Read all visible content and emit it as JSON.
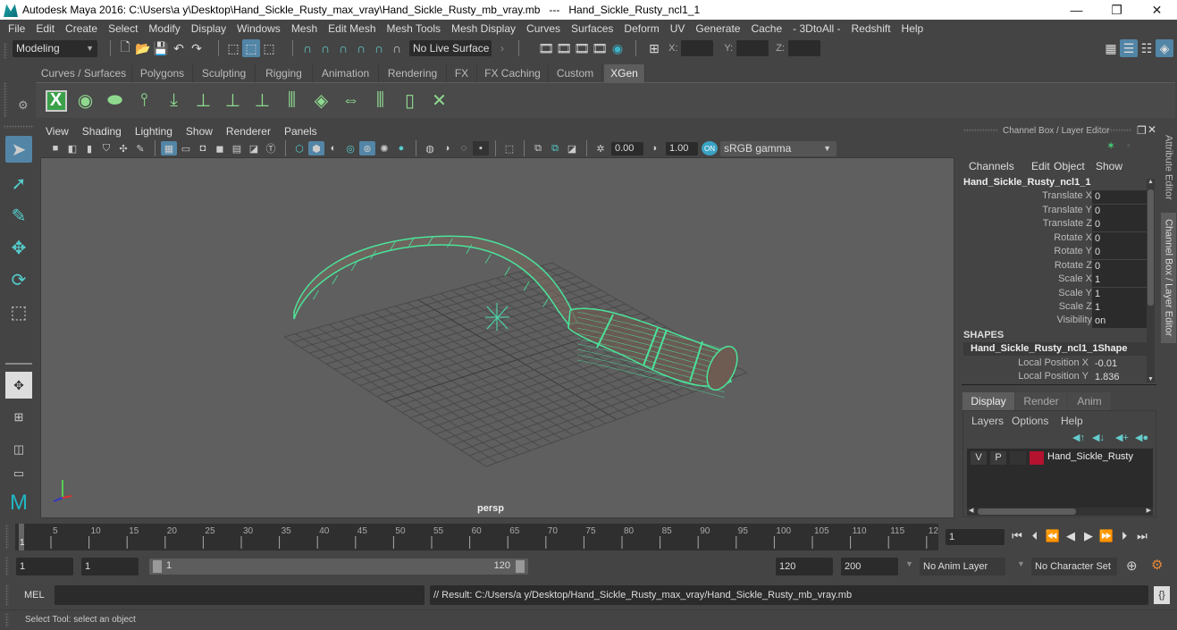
{
  "titlebar": {
    "title": "Autodesk Maya 2016: C:\\Users\\a y\\Desktop\\Hand_Sickle_Rusty_max_vray\\Hand_Sickle_Rusty_mb_vray.mb   ---   Hand_Sickle_Rusty_ncl1_1",
    "minimize": "—",
    "restore": "❐",
    "close": "✕"
  },
  "menubar": [
    "File",
    "Edit",
    "Create",
    "Select",
    "Modify",
    "Display",
    "Windows",
    "Mesh",
    "Edit Mesh",
    "Mesh Tools",
    "Mesh Display",
    "Curves",
    "Surfaces",
    "Deform",
    "UV",
    "Generate",
    "Cache",
    "- 3DtoAll -",
    "Redshift",
    "Help"
  ],
  "statusline": {
    "mode": "Modeling",
    "live_surface": "No Live Surface",
    "x_label": "X:",
    "y_label": "Y:",
    "z_label": "Z:",
    "x_value": "",
    "y_value": "",
    "z_value": ""
  },
  "shelf_tabs": [
    {
      "label": "Curves / Surfaces",
      "active": false
    },
    {
      "label": "Polygons",
      "active": false
    },
    {
      "label": "Sculpting",
      "active": false
    },
    {
      "label": "Rigging",
      "active": false
    },
    {
      "label": "Animation",
      "active": false
    },
    {
      "label": "Rendering",
      "active": false
    },
    {
      "label": "FX",
      "active": false
    },
    {
      "label": "FX Caching",
      "active": false
    },
    {
      "label": "Custom",
      "active": false
    },
    {
      "label": "XGen",
      "active": true
    }
  ],
  "shelf_icons": [
    "xgen-library-icon",
    "xgen-preview-icon",
    "xgen-clear-icon",
    "add-guides-icon",
    "place-guides-icon",
    "add-primitive-icon",
    "sculpt-guides-icon",
    "lock-length-icon",
    "guides-to-curves-icon",
    "xgen-tiles-icon",
    "interactive-groom-icon",
    "xgen-select-icon",
    "xgen-toggle-icon",
    "delete-description-icon"
  ],
  "panel": {
    "menus": [
      "View",
      "Shading",
      "Lighting",
      "Show",
      "Renderer",
      "Panels"
    ],
    "exposure": "0.00",
    "gamma": "1.00",
    "color_space": "sRGB gamma",
    "camera_label": "persp"
  },
  "channel_box": {
    "title": "Channel Box / Layer Editor",
    "menus": [
      "Channels",
      "Edit",
      "Object",
      "Show"
    ],
    "object_name": "Hand_Sickle_Rusty_ncl1_1",
    "attributes": [
      {
        "label": "Translate X",
        "value": "0"
      },
      {
        "label": "Translate Y",
        "value": "0"
      },
      {
        "label": "Translate Z",
        "value": "0"
      },
      {
        "label": "Rotate X",
        "value": "0"
      },
      {
        "label": "Rotate Y",
        "value": "0"
      },
      {
        "label": "Rotate Z",
        "value": "0"
      },
      {
        "label": "Scale X",
        "value": "1"
      },
      {
        "label": "Scale Y",
        "value": "1"
      },
      {
        "label": "Scale Z",
        "value": "1"
      },
      {
        "label": "Visibility",
        "value": "on"
      }
    ],
    "shapes_header": "SHAPES",
    "shape_name": "Hand_Sickle_Rusty_ncl1_1Shape",
    "shape_attributes": [
      {
        "label": "Local Position X",
        "value": "-0.01"
      },
      {
        "label": "Local Position Y",
        "value": "1.836"
      }
    ]
  },
  "layer_editor": {
    "tabs": [
      {
        "label": "Display",
        "active": true
      },
      {
        "label": "Render",
        "active": false
      },
      {
        "label": "Anim",
        "active": false
      }
    ],
    "menus": [
      "Layers",
      "Options",
      "Help"
    ],
    "layers": [
      {
        "v": "V",
        "p": "P",
        "color": "#b5122f",
        "name": "Hand_Sickle_Rusty"
      }
    ]
  },
  "side_tabs": [
    "Attribute Editor",
    "Channel Box / Layer Editor"
  ],
  "timeline": {
    "ticks": [
      "5",
      "10",
      "15",
      "20",
      "25",
      "30",
      "35",
      "40",
      "45",
      "50",
      "55",
      "60",
      "65",
      "70",
      "75",
      "80",
      "85",
      "90",
      "95",
      "100",
      "105",
      "110",
      "115",
      "12"
    ],
    "current_marker": "1",
    "current_frame": "1"
  },
  "range": {
    "start": "1",
    "playback_start": "1",
    "slider_start": "1",
    "slider_end": "120",
    "playback_end": "120",
    "end": "200",
    "anim_layer": "No Anim Layer",
    "character_set": "No Character Set"
  },
  "command_line": {
    "language": "MEL",
    "input": "",
    "result": "// Result: C:/Users/a y/Desktop/Hand_Sickle_Rusty_max_vray/Hand_Sickle_Rusty_mb_vray.mb"
  },
  "help_line": "Select Tool: select an object",
  "colors": {
    "accent": "#5285a6",
    "wireframe": "#4be39a",
    "layer_color": "#b5122f",
    "viewport_bg": "#5f5f5f"
  }
}
